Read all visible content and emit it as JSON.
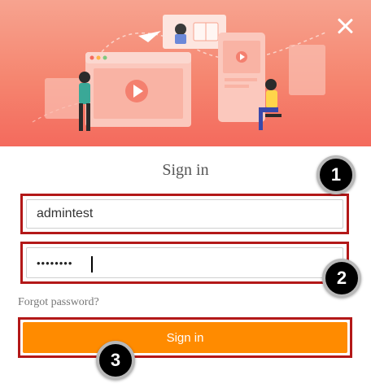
{
  "dialog": {
    "title": "Sign in",
    "username": {
      "value": "admintest",
      "placeholder": ""
    },
    "password": {
      "value": "••••••••",
      "placeholder": ""
    },
    "forgot_password_label": "Forgot password?",
    "signin_button_label": "Sign in",
    "close_icon": "close-icon"
  },
  "steps": [
    "1",
    "2",
    "3"
  ],
  "colors": {
    "header_top": "#f7a38f",
    "header_bottom": "#f46a5d",
    "annotation_border": "#b31818",
    "button_bg": "#ff8b00",
    "button_text": "#ffffff"
  }
}
